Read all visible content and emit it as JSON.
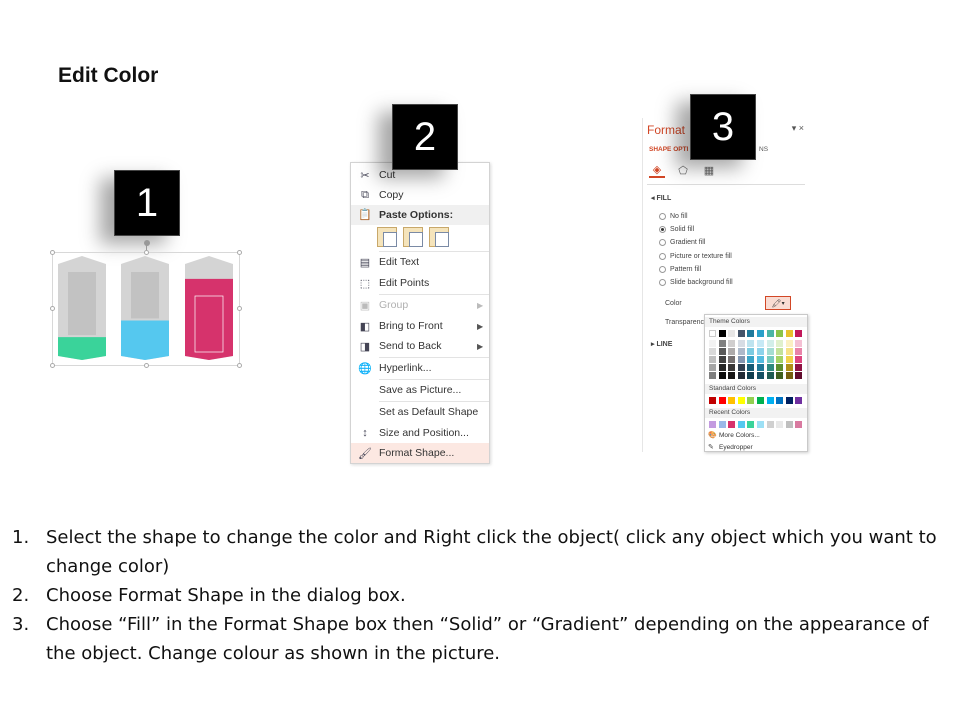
{
  "title": "Edit Color",
  "badges": [
    "1",
    "2",
    "3"
  ],
  "shapes": [
    {
      "fill_color": "#3ad39a",
      "fill_level": 0.22
    },
    {
      "fill_color": "#55c8ef",
      "fill_level": 0.38
    },
    {
      "fill_color": "#d6336c",
      "fill_level": 0.78,
      "selected": true
    }
  ],
  "context_menu": {
    "items": [
      {
        "label": "Cut",
        "icon": "scissors-icon"
      },
      {
        "label": "Copy",
        "icon": "copy-icon"
      },
      {
        "section": "Paste Options:",
        "icon": "clipboard-icon"
      },
      {
        "label": "Edit Text",
        "icon": "edit-text-icon"
      },
      {
        "label": "Edit Points",
        "icon": "edit-points-icon"
      },
      {
        "label": "Group",
        "icon": "group-icon",
        "disabled": true,
        "submenu": true
      },
      {
        "label": "Bring to Front",
        "icon": "bring-front-icon",
        "submenu": true
      },
      {
        "label": "Send to Back",
        "icon": "send-back-icon",
        "submenu": true
      },
      {
        "label": "Hyperlink...",
        "icon": "hyperlink-icon"
      },
      {
        "label": "Save as Picture...",
        "icon": ""
      },
      {
        "label": "Set as Default Shape",
        "icon": ""
      },
      {
        "label": "Size and Position...",
        "icon": "size-icon"
      },
      {
        "label": "Format Shape...",
        "icon": "format-shape-icon",
        "highlighted": true
      }
    ]
  },
  "format_pane": {
    "title": "Format",
    "close": "▾ ×",
    "tab_label": "SHAPE OPTI",
    "tab_label_2": "NS",
    "fill_header": "◂ FILL",
    "fill_options": [
      {
        "label": "No fill",
        "selected": false
      },
      {
        "label": "Solid fill",
        "selected": true
      },
      {
        "label": "Gradient fill",
        "selected": false
      },
      {
        "label": "Picture or texture fill",
        "selected": false
      },
      {
        "label": "Pattern fill",
        "selected": false
      },
      {
        "label": "Slide background fill",
        "selected": false
      }
    ],
    "color_label": "Color",
    "transparency_label": "Transparenc",
    "line_header": "▸ LINE",
    "palette": {
      "theme_header": "Theme Colors",
      "standard_header": "Standard Colors",
      "recent_header": "Recent Colors",
      "more_colors": "More Colors...",
      "eyedropper": "Eyedropper",
      "theme_top": [
        "#ffffff",
        "#000000",
        "#e7e6e6",
        "#44546a",
        "#1f7a9c",
        "#2aa0c9",
        "#4bb5a6",
        "#8bc34a",
        "#e8c12e",
        "#c2185b"
      ],
      "theme_shades": [
        [
          "#f2f2f2",
          "#808080",
          "#d0cece",
          "#d6dce4",
          "#bde3ef",
          "#c6e9f5",
          "#d2eee9",
          "#e0f0cc",
          "#fbf0c3",
          "#f4c1d4"
        ],
        [
          "#d9d9d9",
          "#595959",
          "#aeabab",
          "#adb9ca",
          "#7ccbe1",
          "#8dd3eb",
          "#a4ddd3",
          "#c3e29a",
          "#f7e186",
          "#e983a9"
        ],
        [
          "#bfbfbf",
          "#404040",
          "#757070",
          "#8496b0",
          "#3aa5c8",
          "#54bde0",
          "#75cbbf",
          "#a5d365",
          "#f2d24a",
          "#dd457f"
        ],
        [
          "#a6a6a6",
          "#262626",
          "#3a3838",
          "#323f4f",
          "#175c75",
          "#1f7896",
          "#2f8a7d",
          "#5e8f2d",
          "#b08f16",
          "#911244"
        ],
        [
          "#7f7f7f",
          "#0d0d0d",
          "#171616",
          "#222a35",
          "#0f3d4e",
          "#155064",
          "#1f5c53",
          "#3f601e",
          "#755f0f",
          "#610c2d"
        ]
      ],
      "standard": [
        "#c00000",
        "#ff0000",
        "#ffc000",
        "#ffff00",
        "#92d050",
        "#00b050",
        "#00b0f0",
        "#0070c0",
        "#002060",
        "#7030a0"
      ],
      "recent": [
        "#c39be0",
        "#9ab9e8",
        "#d6336c",
        "#55c8ef",
        "#3ad39a",
        "#9de0f5",
        "#d0d0d0",
        "#e8e8e8",
        "#bfbfbf",
        "#d97aa0"
      ]
    }
  },
  "steps": [
    {
      "n": "1.",
      "text": "Select the shape to change the color and Right click the object( click any object which you want to change color)"
    },
    {
      "n": "2.",
      "text": "Choose Format Shape in the dialog box."
    },
    {
      "n": "3.",
      "text": "Choose “Fill” in the Format Shape box then “Solid” or “Gradient” depending on the appearance of the object. Change colour as shown in the picture."
    }
  ]
}
